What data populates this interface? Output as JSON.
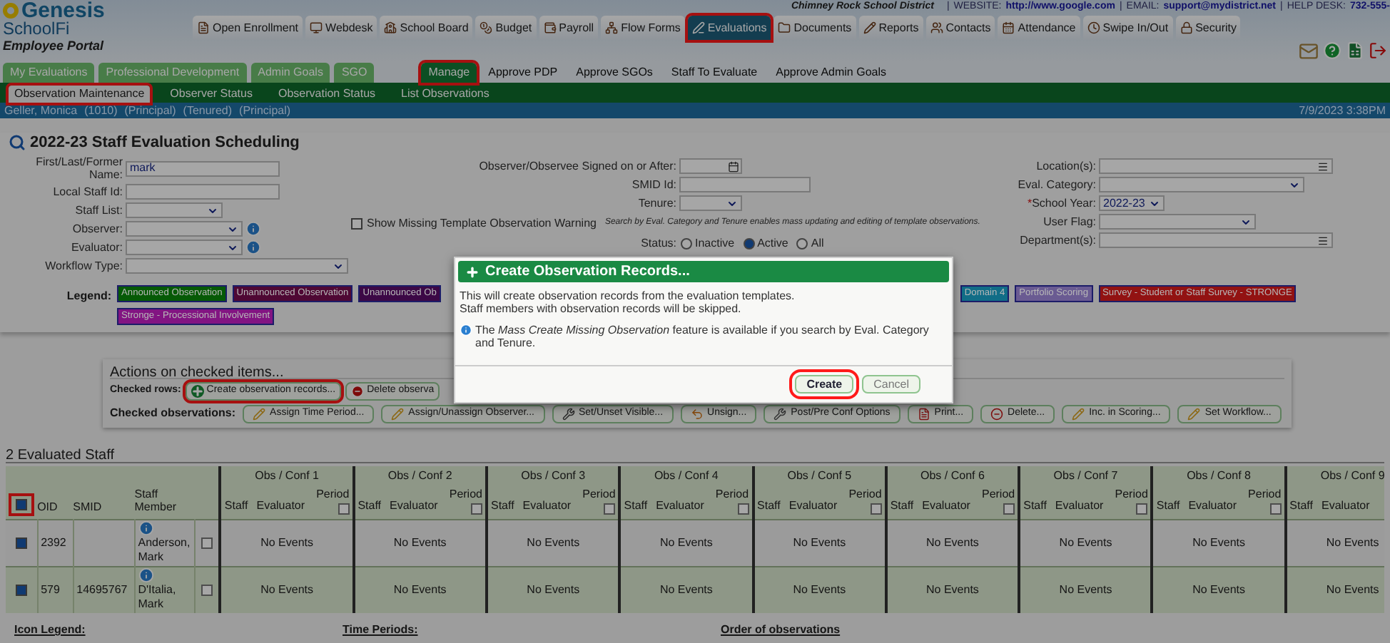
{
  "header": {
    "district": "Chimney Rock School District",
    "separator": "|",
    "website_label": "WEBSITE:",
    "website": "http://www.google.com",
    "email_label": "EMAIL:",
    "email": "support@mydistrict.net",
    "helpdesk_label": "HELP DESK:",
    "helpdesk": "732-555-"
  },
  "logo": {
    "name": "Genesis",
    "product": "SchoolFi",
    "portal": "Employee Portal"
  },
  "nav_tabs": [
    {
      "label": "Open Enrollment",
      "selected": false,
      "highlighted": false
    },
    {
      "label": "Webdesk",
      "selected": false,
      "highlighted": false
    },
    {
      "label": "School Board",
      "selected": false,
      "highlighted": false
    },
    {
      "label": "Budget",
      "selected": false,
      "highlighted": false
    },
    {
      "label": "Payroll",
      "selected": false,
      "highlighted": false
    },
    {
      "label": "Flow Forms",
      "selected": false,
      "highlighted": false
    },
    {
      "label": "Evaluations",
      "selected": true,
      "highlighted": true
    },
    {
      "label": "Documents",
      "selected": false,
      "highlighted": false
    },
    {
      "label": "Reports",
      "selected": false,
      "highlighted": false
    },
    {
      "label": "Contacts",
      "selected": false,
      "highlighted": false
    },
    {
      "label": "Attendance",
      "selected": false,
      "highlighted": false
    },
    {
      "label": "Swipe In/Out",
      "selected": false,
      "highlighted": false
    },
    {
      "label": "Security",
      "selected": false,
      "highlighted": false
    }
  ],
  "sub_tabs": [
    {
      "label": "My Evaluations",
      "kind": "tab",
      "selected": false,
      "highlighted": false
    },
    {
      "label": "Professional Development",
      "kind": "tab",
      "selected": false,
      "highlighted": false
    },
    {
      "label": "Admin Goals",
      "kind": "tab",
      "selected": false,
      "highlighted": false
    },
    {
      "label": "SGO",
      "kind": "tab",
      "selected": false,
      "highlighted": false
    },
    {
      "label": "Manage",
      "kind": "tab",
      "selected": true,
      "highlighted": true
    },
    {
      "label": "Approve PDP",
      "kind": "link",
      "selected": false,
      "highlighted": false
    },
    {
      "label": "Approve SGOs",
      "kind": "link",
      "selected": false,
      "highlighted": false
    },
    {
      "label": "Staff To Evaluate",
      "kind": "link",
      "selected": false,
      "highlighted": false
    },
    {
      "label": "Approve Admin Goals",
      "kind": "link",
      "selected": false,
      "highlighted": false
    }
  ],
  "section_tabs": [
    {
      "label": "Observation Maintenance",
      "selected": true,
      "highlighted": true
    },
    {
      "label": "Observer Status",
      "selected": false,
      "highlighted": false
    },
    {
      "label": "Observation Status",
      "selected": false,
      "highlighted": false
    },
    {
      "label": "List Observations",
      "selected": false,
      "highlighted": false
    }
  ],
  "user_bar": {
    "user": "Geller, Monica",
    "id": "(1010)",
    "tags": [
      "(Principal)",
      "(Tenured)",
      "(Principal)"
    ],
    "datetime": "7/9/2023 3:38PM"
  },
  "search": {
    "title": "2022-23 Staff Evaluation Scheduling",
    "left_fields": [
      {
        "label": "First/Last/Former Name:",
        "kind": "text",
        "value": "mark"
      },
      {
        "label": "Local Staff Id:",
        "kind": "text"
      },
      {
        "label": "Staff List:",
        "kind": "select"
      },
      {
        "label": "Observer:",
        "kind": "select_info"
      },
      {
        "label": "Evaluator:",
        "kind": "select_info"
      },
      {
        "label": "Workflow Type:",
        "kind": "wide_select"
      }
    ],
    "middle_fields": [
      {
        "label": "Observer/Observee Signed on or After:",
        "kind": "date"
      },
      {
        "label": "SMID Id:",
        "kind": "text"
      },
      {
        "label": "Tenure:",
        "kind": "select"
      }
    ],
    "missing_warning": {
      "label": "Show Missing Template Observation Warning",
      "checked": false,
      "note": "Search by Eval. Category and Tenure enables mass updating and editing of template observations."
    },
    "status": {
      "label": "Status:",
      "options": [
        {
          "label": "Inactive",
          "selected": false
        },
        {
          "label": "Active",
          "selected": true
        },
        {
          "label": "All",
          "selected": false
        }
      ]
    },
    "required_mark": "*",
    "right_fields": [
      {
        "label": "Location(s):",
        "kind": "list"
      },
      {
        "label": "Eval. Category:",
        "kind": "select",
        "required": false
      },
      {
        "label": "School Year:",
        "kind": "small_select",
        "required": true,
        "value": "2022-23"
      },
      {
        "label": "User Flag:",
        "kind": "select",
        "required": false
      },
      {
        "label": "Department(s):",
        "kind": "list"
      }
    ],
    "legend_label": "Legend:",
    "legend": [
      {
        "label": "Announced Observation",
        "color": "#065a06"
      },
      {
        "label": "Unannounced Observation",
        "color": "#4f0834"
      },
      {
        "label": "Unannounced Ob",
        "color": "#3c0846"
      },
      {
        "label": "Domain 4",
        "color": "#116d87"
      },
      {
        "label": "Portfolio Scoring",
        "color": "#6a5b92"
      },
      {
        "label": "Survey - Student or Staff Survey - STRONGE",
        "color": "#921212"
      },
      {
        "label": "Stronge - Processional Involvement",
        "color": "#821482"
      }
    ]
  },
  "actions": {
    "title": "Actions on checked items...",
    "rows_label": "Checked rows:",
    "row_buttons": [
      {
        "label": "Create observation records...",
        "highlighted": true
      },
      {
        "label": "Delete observa",
        "highlighted": false
      }
    ],
    "obs_label": "Checked observations:",
    "obs_buttons": [
      "Assign Time Period...",
      "Assign/Unassign Observer...",
      "Set/Unset Visible...",
      "Unsign...",
      "Post/Pre Conf Options",
      "Print...",
      "Delete...",
      "Inc. in Scoring...",
      "Set Workflow..."
    ]
  },
  "staff_table": {
    "title": "2 Evaluated Staff",
    "select_all": {
      "checked": true,
      "highlighted": true
    },
    "columns": [
      "OID",
      "SMID",
      "Staff Member"
    ],
    "obs_columns": [
      {
        "title": "Obs / Conf 1",
        "staff": "Staff",
        "evaluator": "Evaluator",
        "period": "Period",
        "period_checked": false
      },
      {
        "title": "Obs / Conf 2",
        "staff": "Staff",
        "evaluator": "Evaluator",
        "period": "Period",
        "period_checked": false
      },
      {
        "title": "Obs / Conf 3",
        "staff": "Staff",
        "evaluator": "Evaluator",
        "period": "Period",
        "period_checked": false
      },
      {
        "title": "Obs / Conf 4",
        "staff": "Staff",
        "evaluator": "Evaluator",
        "period": "Period",
        "period_checked": false
      },
      {
        "title": "Obs / Conf 5",
        "staff": "Staff",
        "evaluator": "Evaluator",
        "period": "Period",
        "period_checked": false
      },
      {
        "title": "Obs / Conf 6",
        "staff": "Staff",
        "evaluator": "Evaluator",
        "period": "Period",
        "period_checked": false
      },
      {
        "title": "Obs / Conf 7",
        "staff": "Staff",
        "evaluator": "Evaluator",
        "period": "Period",
        "period_checked": false
      },
      {
        "title": "Obs / Conf 8",
        "staff": "Staff",
        "evaluator": "Evaluator",
        "period": "Period",
        "period_checked": false
      },
      {
        "title": "Obs / Conf 9",
        "staff": "Staff",
        "evaluator": "Evaluator"
      }
    ],
    "rows": [
      {
        "checked": true,
        "oid": "2392",
        "name": "Anderson, Mark",
        "row_checked": false,
        "cells": [
          "No Events",
          "No Events",
          "No Events",
          "No Events",
          "No Events",
          "No Events",
          "No Events",
          "No Events",
          "No Events"
        ]
      },
      {
        "checked": true,
        "oid": "579",
        "smid": "14695767",
        "name": "D'Italia, Mark",
        "row_checked": false,
        "cells": [
          "No Events",
          "No Events",
          "No Events",
          "No Events",
          "No Events",
          "No Events",
          "No Events",
          "No Events",
          "No Events"
        ]
      }
    ]
  },
  "footer": {
    "icon_legend": "Icon Legend:",
    "time_periods": "Time Periods:",
    "order": "Order of observations"
  },
  "modal": {
    "title": "Create Observation Records...",
    "lines": [
      "This will create observation records from the evaluation templates.",
      "Staff members with observation records will be skipped."
    ],
    "info": "The *Mass Create Missing Observation* feature is available if you search by Eval. Category and Tenure.",
    "buttons": [
      {
        "label": "Create",
        "kind": "primary",
        "highlighted": true
      },
      {
        "label": "Cancel",
        "kind": "secondary",
        "highlighted": false
      }
    ]
  }
}
